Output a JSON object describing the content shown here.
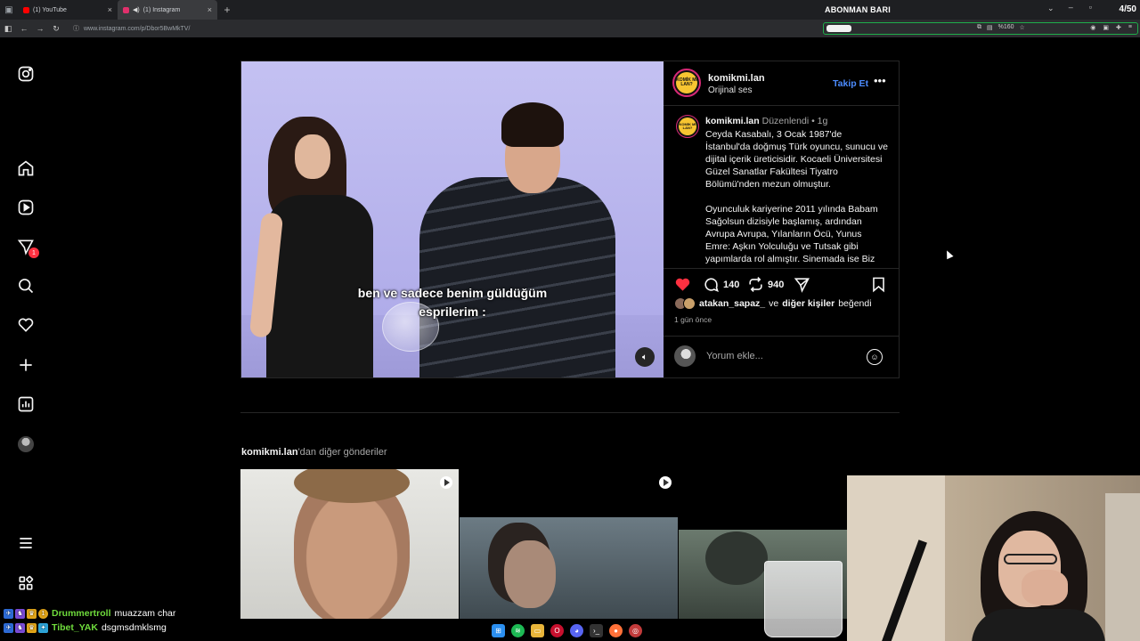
{
  "browser": {
    "tabs": [
      {
        "label": "(1) YouTube",
        "favicon_color": "#ff0000"
      },
      {
        "label": "(1) Instagram",
        "favicon_color": "#e1306c"
      }
    ],
    "new_tab_icon": "+",
    "url": "www.instagram.com/p/Dbor5BwMkTV/",
    "right_label": "ABONMAN BARI",
    "counter": "4/50",
    "zoom": "%160",
    "progress_fraction": 0.08
  },
  "sidebar": {
    "items": [
      {
        "name": "instagram-logo-icon"
      },
      {
        "name": "home-icon"
      },
      {
        "name": "reels-icon"
      },
      {
        "name": "messages-icon",
        "badge": "1"
      },
      {
        "name": "search-icon"
      },
      {
        "name": "notifications-icon"
      },
      {
        "name": "create-icon"
      },
      {
        "name": "insights-icon"
      },
      {
        "name": "profile-avatar"
      },
      {
        "name": "menu-icon"
      },
      {
        "name": "apps-icon"
      }
    ]
  },
  "post": {
    "username": "komikmi.lan",
    "audio": "Orijinal ses",
    "follow_label": "Takip Et",
    "logo_text": "KOMİK Mİ LAN?",
    "subtitle_line1": "ben ve sadece benim güldüğüm",
    "subtitle_line2": "esprilerim :",
    "caption_username": "komikmi.lan",
    "caption_meta": "Düzenlendi • 1g",
    "caption_p1": "Ceyda Kasabalı, 3 Ocak 1987'de İstanbul'da doğmuş Türk oyuncu, sunucu ve dijital içerik üreticisidir. Kocaeli Üniversitesi Güzel Sanatlar Fakültesi Tiyatro Bölümü'nden mezun olmuştur.",
    "caption_p2": "Oyunculuk kariyerine 2011 yılında Babam Sağolsun dizisiyle başlamış, ardından Avrupa Avrupa, Yılanların Öcü, Yunus Emre: Aşkın Yolculuğu ve Tutsak gibi yapımlarda rol almıştır. Sinemada ise Biz",
    "comments_count": "140",
    "reposts_count": "940",
    "liked_by_user": "atakan_sapaz_",
    "liked_by_connector": "ve",
    "liked_by_others": "diğer kişiler",
    "liked_by_suffix": "beğendi",
    "time_ago": "1 gün önce",
    "comment_placeholder": "Yorum ekle...",
    "like_color": "#ff3040"
  },
  "more_posts": {
    "username": "komikmi.lan",
    "suffix": "'dan diğer gönderiler"
  },
  "chat": [
    {
      "user": "Drummertroll",
      "message": "muazzam char",
      "user_color": "#6fdc3c"
    },
    {
      "user": "Tibet_YAK",
      "message": "dsgmsdmklsmg",
      "user_color": "#6fdc3c"
    }
  ]
}
